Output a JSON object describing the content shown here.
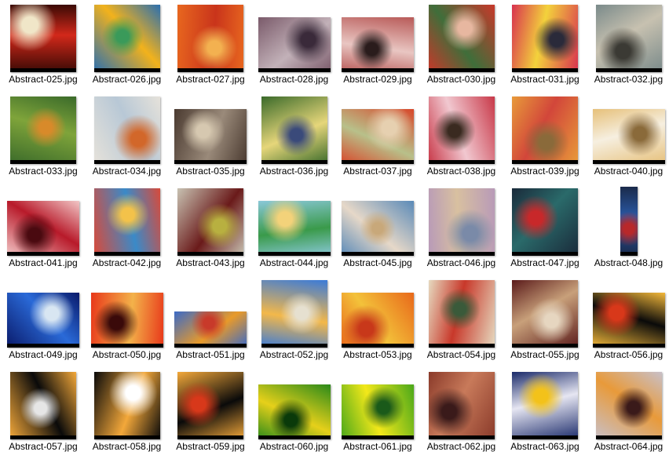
{
  "files": [
    {
      "name": "Abstract-025.jpg",
      "orient": "portrait",
      "colors": [
        "#3a0a05",
        "#d2281a",
        "#f0e6c8"
      ]
    },
    {
      "name": "Abstract-026.jpg",
      "orient": "portrait",
      "colors": [
        "#2a6fb0",
        "#f2b21c",
        "#3a9a5a"
      ]
    },
    {
      "name": "Abstract-027.jpg",
      "orient": "portrait",
      "colors": [
        "#e8671f",
        "#c9341b",
        "#f3b150"
      ]
    },
    {
      "name": "Abstract-028.jpg",
      "orient": "landscape",
      "colors": [
        "#7a5a6a",
        "#c2b1b8",
        "#3a2a3a"
      ]
    },
    {
      "name": "Abstract-029.jpg",
      "orient": "landscape",
      "colors": [
        "#b85a58",
        "#e9c6c2",
        "#2a1c1c"
      ]
    },
    {
      "name": "Abstract-030.jpg",
      "orient": "portrait",
      "colors": [
        "#c8382a",
        "#3f6e3a",
        "#e7b7a0"
      ]
    },
    {
      "name": "Abstract-031.jpg",
      "orient": "portrait",
      "colors": [
        "#d8324f",
        "#f3d23c",
        "#2a2a3a"
      ]
    },
    {
      "name": "Abstract-032.jpg",
      "orient": "portrait",
      "colors": [
        "#7a8a8a",
        "#c7c1b0",
        "#3b3a34"
      ]
    },
    {
      "name": "Abstract-033.jpg",
      "orient": "portrait",
      "colors": [
        "#3a6a2a",
        "#7fa43a",
        "#d88a2a"
      ]
    },
    {
      "name": "Abstract-034.jpg",
      "orient": "portrait",
      "colors": [
        "#e6e2da",
        "#b8c8d6",
        "#d2672a"
      ]
    },
    {
      "name": "Abstract-035.jpg",
      "orient": "landscape",
      "colors": [
        "#4a3a30",
        "#9a8a7a",
        "#d6c8b0"
      ]
    },
    {
      "name": "Abstract-036.jpg",
      "orient": "portrait",
      "colors": [
        "#3a6a2a",
        "#e6d67a",
        "#3a4a7a"
      ]
    },
    {
      "name": "Abstract-037.jpg",
      "orient": "landscape",
      "colors": [
        "#d8472a",
        "#b8c08a",
        "#e6d0b0"
      ]
    },
    {
      "name": "Abstract-038.jpg",
      "orient": "portrait",
      "colors": [
        "#c83848",
        "#f1c8d0",
        "#3a2a20"
      ]
    },
    {
      "name": "Abstract-039.jpg",
      "orient": "portrait",
      "colors": [
        "#e89a3a",
        "#d2463a",
        "#8a6a3a"
      ]
    },
    {
      "name": "Abstract-040.jpg",
      "orient": "landscape",
      "colors": [
        "#e6c07a",
        "#f6efe0",
        "#8a6a3a"
      ]
    },
    {
      "name": "Abstract-041.jpg",
      "orient": "landscape",
      "colors": [
        "#f2c6c6",
        "#b81a2a",
        "#4a0a10"
      ]
    },
    {
      "name": "Abstract-042.jpg",
      "orient": "portrait",
      "colors": [
        "#d84a3a",
        "#3a8ac8",
        "#f3c24a"
      ]
    },
    {
      "name": "Abstract-043.jpg",
      "orient": "portrait",
      "colors": [
        "#c8c2b2",
        "#6a1a1a",
        "#b8b040"
      ]
    },
    {
      "name": "Abstract-044.jpg",
      "orient": "landscape",
      "colors": [
        "#8ac8d8",
        "#3a9a4a",
        "#f3d27a"
      ]
    },
    {
      "name": "Abstract-045.jpg",
      "orient": "landscape",
      "colors": [
        "#5a8ab8",
        "#e6d8c8",
        "#c8a87a"
      ]
    },
    {
      "name": "Abstract-046.jpg",
      "orient": "portrait",
      "colors": [
        "#b89ab8",
        "#d8c0a0",
        "#7a8aa8"
      ]
    },
    {
      "name": "Abstract-047.jpg",
      "orient": "portrait",
      "colors": [
        "#1a2a3a",
        "#2a6a6a",
        "#c8282a"
      ]
    },
    {
      "name": "Abstract-048.jpg",
      "orient": "narrow",
      "colors": [
        "#1a2a4a",
        "#2a5aa8",
        "#b8282a"
      ]
    },
    {
      "name": "Abstract-049.jpg",
      "orient": "landscape",
      "colors": [
        "#0a1a6a",
        "#2a6ad8",
        "#d8e6f2"
      ]
    },
    {
      "name": "Abstract-050.jpg",
      "orient": "landscape",
      "colors": [
        "#e8381a",
        "#f3b24a",
        "#3a0a0a"
      ]
    },
    {
      "name": "Abstract-051.jpg",
      "orient": "wide",
      "colors": [
        "#3a6ac8",
        "#e89a2a",
        "#c83a2a"
      ]
    },
    {
      "name": "Abstract-052.jpg",
      "orient": "portrait",
      "colors": [
        "#3a7ad8",
        "#f3b84a",
        "#e6e0d0"
      ]
    },
    {
      "name": "Abstract-053.jpg",
      "orient": "landscape",
      "colors": [
        "#e8681a",
        "#f3c23a",
        "#c8381a"
      ]
    },
    {
      "name": "Abstract-054.jpg",
      "orient": "portrait",
      "colors": [
        "#e6dac0",
        "#c8382a",
        "#3a5a3a"
      ]
    },
    {
      "name": "Abstract-055.jpg",
      "orient": "portrait",
      "colors": [
        "#5a1a1a",
        "#c8a07a",
        "#e6d6c0"
      ]
    },
    {
      "name": "Abstract-056.jpg",
      "orient": "landscape",
      "colors": [
        "#f3b83a",
        "#0a0a0a",
        "#d8381a"
      ]
    },
    {
      "name": "Abstract-057.jpg",
      "orient": "portrait",
      "colors": [
        "#f3a83a",
        "#0a0a0a",
        "#e6e6e6"
      ]
    },
    {
      "name": "Abstract-058.jpg",
      "orient": "portrait",
      "colors": [
        "#0a0a0a",
        "#f3a83a",
        "#ffffff"
      ]
    },
    {
      "name": "Abstract-059.jpg",
      "orient": "portrait",
      "colors": [
        "#f3a83a",
        "#0a0a0a",
        "#d8381a"
      ]
    },
    {
      "name": "Abstract-060.jpg",
      "orient": "landscape",
      "colors": [
        "#2a8a1a",
        "#e6d01a",
        "#0a3a0a"
      ]
    },
    {
      "name": "Abstract-061.jpg",
      "orient": "landscape",
      "colors": [
        "#4aa81a",
        "#f3e81a",
        "#1a5a1a"
      ]
    },
    {
      "name": "Abstract-062.jpg",
      "orient": "portrait",
      "colors": [
        "#8a3a2a",
        "#c87a5a",
        "#3a1a1a"
      ]
    },
    {
      "name": "Abstract-063.jpg",
      "orient": "portrait",
      "colors": [
        "#1a2a6a",
        "#e6e6f2",
        "#f3c21a"
      ]
    },
    {
      "name": "Abstract-064.jpg",
      "orient": "portrait",
      "colors": [
        "#c8c0c8",
        "#e89a3a",
        "#3a1a1a"
      ]
    }
  ]
}
